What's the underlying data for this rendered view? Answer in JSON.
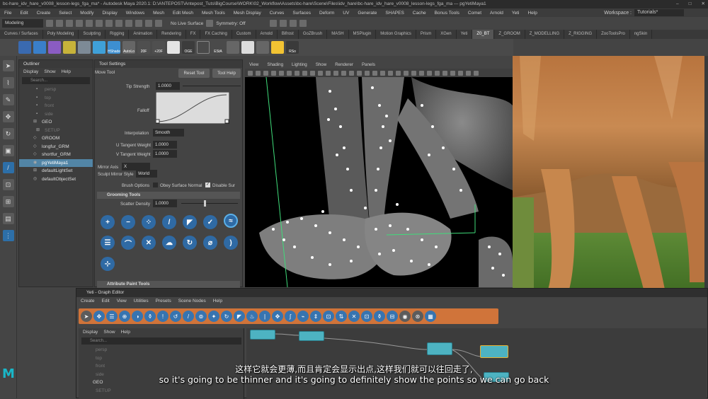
{
  "window": {
    "title": "bc-hare_idv_hare_v0008_lesson-legs_fga_ma* - Autodesk Maya 2020.1: D:\\ANTEPOST\\Antepost_Tuts\\BigCourse\\WORK\\02_Workflow\\Assets\\bc-hare\\Scene\\Files\\idv_hare\\bc-hare_idv_hare_v0008_lesson-legs_fga_ma --- pgYetiMaya1",
    "controls": [
      "–",
      "□",
      "✕"
    ]
  },
  "menubar": {
    "items": [
      "File",
      "Edit",
      "Create",
      "Select",
      "Modify",
      "Display",
      "Windows",
      "Mesh",
      "Edit Mesh",
      "Mesh Tools",
      "Mesh Display",
      "Curves",
      "Surfaces",
      "Deform",
      "UV",
      "Generate",
      "SHAPES",
      "Cache",
      "Bonus Tools",
      "Comet",
      "Arnold",
      "Yeti",
      "Help"
    ],
    "workspace_label": "Workspace :",
    "workspace_value": "Tutorials*"
  },
  "statusline": {
    "mode": "Modeling",
    "live_surface": "No Live Surface",
    "symmetry": "Symmetry: Off"
  },
  "shelf_tabs": [
    "Curves / Surfaces",
    "Poly Modeling",
    "Sculpting",
    "Rigging",
    "Animation",
    "Rendering",
    "FX",
    "FX Caching",
    "Custom",
    "Arnold",
    "Bifrost",
    "GoZBrush",
    "MASH",
    "MSPlugin",
    "Motion Graphics",
    "Prism",
    "XGen",
    "Yeti",
    "Z0_BT",
    "Z_GROOM",
    "Z_MODELLING",
    "Z_RIGGING",
    "ZooToolsPro",
    "ngSkin"
  ],
  "shelf_active": "Z0_BT",
  "shelf_labels": [
    "HShade",
    "AutoLo",
    "20F",
    "+20F",
    "OGE",
    "EStA",
    "RSo"
  ],
  "outliner": {
    "title": "Outliner",
    "menu": [
      "Display",
      "Show",
      "Help"
    ],
    "search_placeholder": "Search...",
    "items": [
      {
        "label": "persp",
        "dim": true,
        "glyph": "▪"
      },
      {
        "label": "top",
        "dim": true,
        "glyph": "▪"
      },
      {
        "label": "front",
        "dim": true,
        "glyph": "▪"
      },
      {
        "label": "side",
        "dim": true,
        "glyph": "▪"
      },
      {
        "label": "GEO",
        "dim": false,
        "glyph": "⊞"
      },
      {
        "label": "SETUP",
        "dim": true,
        "glyph": "⊞"
      },
      {
        "label": "GROOM",
        "dim": false,
        "glyph": "◇"
      },
      {
        "label": "longfur_GRM",
        "dim": false,
        "glyph": "◇"
      },
      {
        "label": "shortfur_GRM",
        "dim": false,
        "glyph": "◇"
      },
      {
        "label": "pgYetiMaya1",
        "dim": false,
        "glyph": "◉",
        "selected": true
      },
      {
        "label": "defaultLightSet",
        "dim": false,
        "glyph": "⊞"
      },
      {
        "label": "defaultObjectSet",
        "dim": false,
        "glyph": "◎"
      }
    ]
  },
  "tool_settings": {
    "title": "Tool Settings",
    "tool_name": "Move Tool",
    "reset_button": "Reset Tool",
    "help_button": "Tool Help",
    "tip_strength_label": "Tip Strength",
    "tip_strength_value": "1.0000",
    "falloff_label": "Falloff",
    "interpolation_label": "Interpolation",
    "interpolation_value": "Smooth",
    "u_tangent_label": "U Tangent Weight",
    "u_tangent_value": "1.0000",
    "v_tangent_label": "V Tangent Weight",
    "v_tangent_value": "1.0000",
    "mirror_axis_label": "Mirror Axis",
    "mirror_axis_value": "X",
    "mirror_style_label": "Sculpt Mirror Style",
    "mirror_style_value": "World",
    "brush_options_label": "Brush Options",
    "obey_surface_label": "Obey Surface Normal",
    "disable_surface_label": "Disable Sur",
    "grooming_section": "Grooming Tools",
    "scatter_density_label": "Scatter Density",
    "scatter_density_value": "1.0000",
    "attribute_section": "Attribute Paint Tools"
  },
  "viewport": {
    "menu": [
      "View",
      "Shading",
      "Lighting",
      "Show",
      "Renderer",
      "Panels"
    ]
  },
  "yeti_editor": {
    "title": "Yeti - Graph Editor",
    "menu": [
      "Create",
      "Edit",
      "View",
      "Utilities",
      "Presets",
      "Scene Nodes",
      "Help"
    ],
    "outliner_menu": [
      "Display",
      "Show",
      "Help"
    ],
    "search_placeholder": "Search...",
    "items": [
      {
        "label": "persp",
        "dim": true
      },
      {
        "label": "top",
        "dim": true
      },
      {
        "label": "front",
        "dim": true
      },
      {
        "label": "side",
        "dim": true
      },
      {
        "label": "GEO",
        "dim": false
      },
      {
        "label": "SETUP",
        "dim": true
      }
    ]
  },
  "subtitles": {
    "chinese": "这样它就会更薄,而且肯定会显示出点,这样我们就可以往回走了,",
    "english": "so it's going to be thinner and it's going to definitely show the points so we can go back"
  },
  "logo_letter": "M",
  "colors": {
    "accent_blue": "#2f6aa4",
    "selection": "#5285a6",
    "yeti_orange": "#d0743a",
    "node_cyan": "#4db3c2"
  }
}
